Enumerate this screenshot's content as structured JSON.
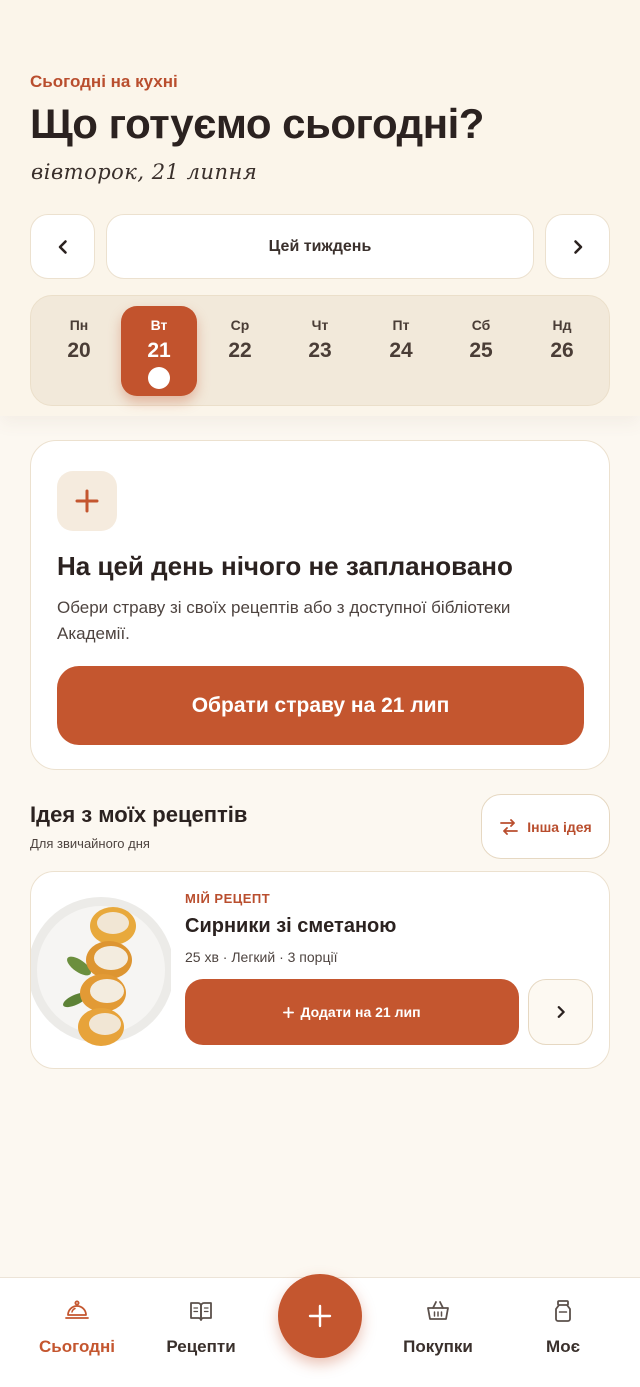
{
  "header": {
    "eyebrow": "Сьогодні на кухні",
    "title": "Що готуємо сьогодні?",
    "date": "вівторок, 21 липня"
  },
  "week": {
    "label": "Цей тиждень",
    "prev_icon": "chevron-left-icon",
    "next_icon": "chevron-right-icon",
    "days": [
      {
        "name": "Пн",
        "date": "20"
      },
      {
        "name": "Вт",
        "date": "21",
        "selected": true
      },
      {
        "name": "Ср",
        "date": "22"
      },
      {
        "name": "Чт",
        "date": "23"
      },
      {
        "name": "Пт",
        "date": "24"
      },
      {
        "name": "Сб",
        "date": "25"
      },
      {
        "name": "Нд",
        "date": "26"
      }
    ]
  },
  "empty_state": {
    "icon": "plus-icon",
    "title": "На цей день нічого не заплановано",
    "text": "Обери страву зі своїх рецептів або з доступної бібліотеки Академії.",
    "cta": "Обрати страву на 21 лип"
  },
  "idea": {
    "title": "Ідея з моїх рецептів",
    "subtitle": "Для звичайного дня",
    "other_button": "Інша ідея",
    "other_icon": "shuffle-arrows-icon",
    "recipe": {
      "badge": "МІЙ РЕЦЕПТ",
      "name": "Сирники зі сметаною",
      "meta": "25 хв · Легкий · 3 порції",
      "add_button": "Додати на 21 лип",
      "add_icon": "plus-icon"
    }
  },
  "tabbar": {
    "tabs": [
      {
        "label": "Сьогодні",
        "icon": "cloche-icon",
        "active": true
      },
      {
        "label": "Рецепти",
        "icon": "book-icon"
      },
      {
        "label": "Покупки",
        "icon": "basket-icon"
      },
      {
        "label": "Моє",
        "icon": "jar-icon"
      }
    ],
    "fab_icon": "plus-icon"
  },
  "colors": {
    "accent": "#c4562f",
    "background": "#fcf8f1",
    "text": "#2b2220"
  }
}
